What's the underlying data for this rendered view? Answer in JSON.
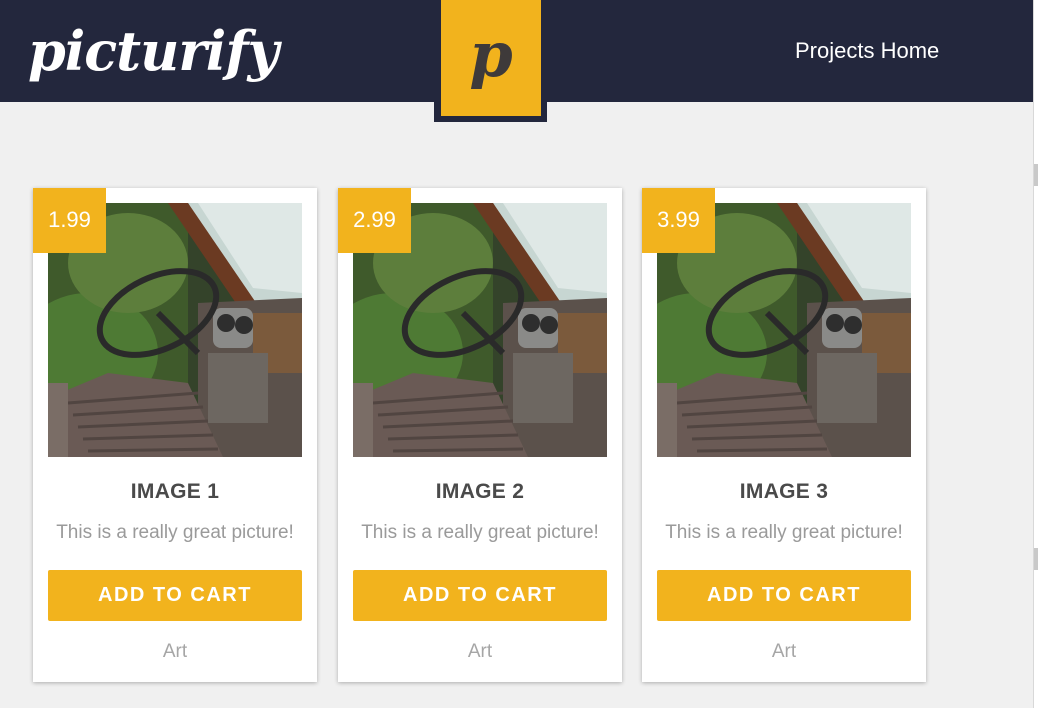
{
  "header": {
    "brand": "picturify",
    "logo_letter": "p",
    "nav_link": "Projects Home"
  },
  "colors": {
    "header_bg": "#23273d",
    "accent": "#f2b31d",
    "page_bg": "#f0f0f0"
  },
  "cards": [
    {
      "price": "1.99",
      "title": "IMAGE 1",
      "description": "This is a really great picture!",
      "button": "ADD TO CART",
      "category": "Art"
    },
    {
      "price": "2.99",
      "title": "IMAGE 2",
      "description": "This is a really great picture!",
      "button": "ADD TO CART",
      "category": "Art"
    },
    {
      "price": "3.99",
      "title": "IMAGE 3",
      "description": "This is a really great picture!",
      "button": "ADD TO CART",
      "category": "Art"
    }
  ]
}
